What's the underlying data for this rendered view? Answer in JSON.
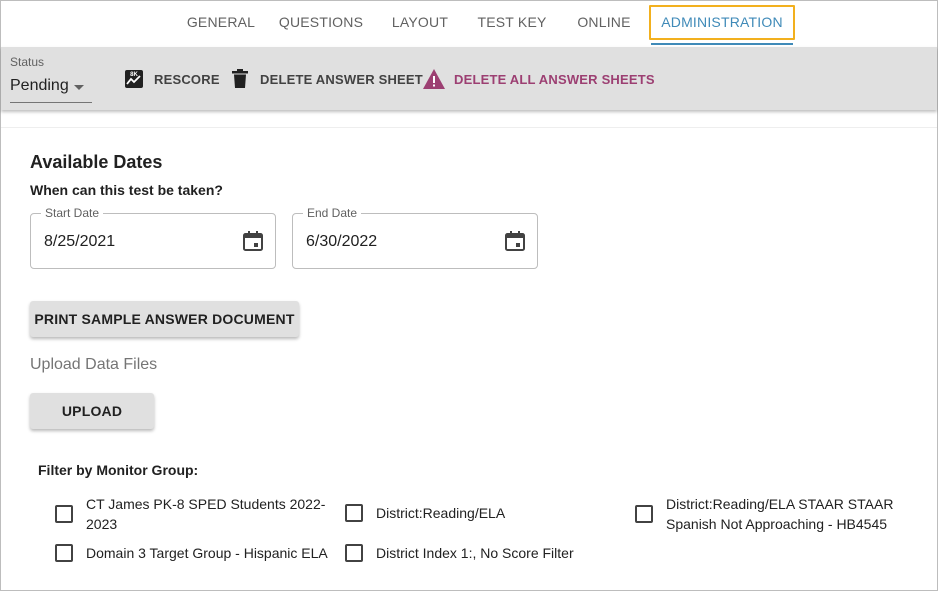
{
  "tabs": [
    {
      "label": "GENERAL",
      "active": false
    },
    {
      "label": "QUESTIONS",
      "active": false
    },
    {
      "label": "LAYOUT",
      "active": false
    },
    {
      "label": "TEST KEY",
      "active": false
    },
    {
      "label": "ONLINE",
      "active": false
    },
    {
      "label": "ADMINISTRATION",
      "active": true
    }
  ],
  "toolbar": {
    "status_label": "Status",
    "status_value": "Pending",
    "rescore_label": "RESCORE",
    "delete_sheet_label": "DELETE ANSWER SHEET",
    "delete_all_label": "DELETE ALL ANSWER SHEETS"
  },
  "available_dates": {
    "title": "Available Dates",
    "question": "When can this test be taken?",
    "start": {
      "label": "Start Date",
      "value": "8/25/2021"
    },
    "end": {
      "label": "End Date",
      "value": "6/30/2022"
    }
  },
  "print_button_label": "PRINT SAMPLE ANSWER DOCUMENT",
  "upload": {
    "title": "Upload Data Files",
    "button_label": "UPLOAD"
  },
  "filter": {
    "title": "Filter by Monitor Group:",
    "groups": [
      {
        "label": "CT James PK-8 SPED Students 2022-2023",
        "checked": false
      },
      {
        "label": "District:Reading/ELA",
        "checked": false
      },
      {
        "label": "District:Reading/ELA STAAR STAAR Spanish Not Approaching - HB4545",
        "checked": false
      },
      {
        "label": "Domain 3 Target Group - Hispanic ELA",
        "checked": false
      },
      {
        "label": "District Index 1:, No Score Filter",
        "checked": false
      }
    ]
  },
  "colors": {
    "accent": "#3f8ab8",
    "highlight": "#f2b01e",
    "danger": "#9c3f72",
    "toolbar_bg": "#e0e0e0"
  }
}
